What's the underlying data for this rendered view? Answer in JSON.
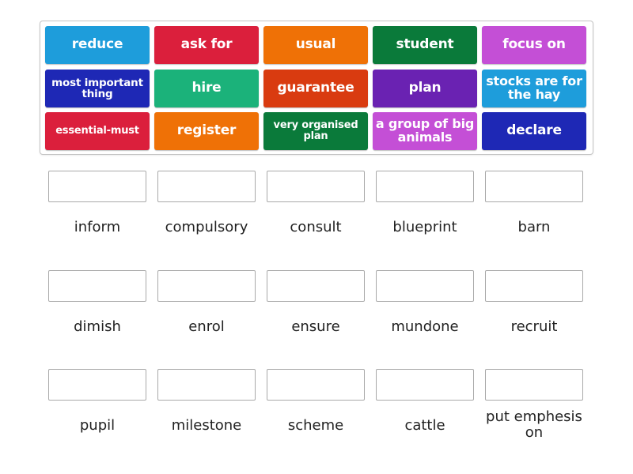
{
  "tiles": [
    {
      "text": "reduce",
      "color": "#1e9ddb"
    },
    {
      "text": "ask for",
      "color": "#db1f3c"
    },
    {
      "text": "usual",
      "color": "#ef7106"
    },
    {
      "text": "student",
      "color": "#0a7a3a"
    },
    {
      "text": "focus on",
      "color": "#c44fd6"
    },
    {
      "text": "most important thing",
      "color": "#1e28b5"
    },
    {
      "text": "hire",
      "color": "#1bb27a"
    },
    {
      "text": "guarantee",
      "color": "#d93b10"
    },
    {
      "text": "plan",
      "color": "#6a22b2"
    },
    {
      "text": "stocks are for the hay",
      "color": "#1e9ddb"
    },
    {
      "text": "essential-must",
      "color": "#db1f3c"
    },
    {
      "text": "register",
      "color": "#ef7106"
    },
    {
      "text": "very organised plan",
      "color": "#0a7a3a"
    },
    {
      "text": "a group of big animals",
      "color": "#c44fd6"
    },
    {
      "text": "declare",
      "color": "#1e28b5"
    }
  ],
  "targets": [
    {
      "label": "inform"
    },
    {
      "label": "compulsory"
    },
    {
      "label": "consult"
    },
    {
      "label": "blueprint"
    },
    {
      "label": "barn"
    },
    {
      "label": "dimish"
    },
    {
      "label": "enrol"
    },
    {
      "label": "ensure"
    },
    {
      "label": "mundone"
    },
    {
      "label": "recruit"
    },
    {
      "label": "pupil"
    },
    {
      "label": "milestone"
    },
    {
      "label": "scheme"
    },
    {
      "label": "cattle"
    },
    {
      "label": "put emphesis on"
    }
  ]
}
